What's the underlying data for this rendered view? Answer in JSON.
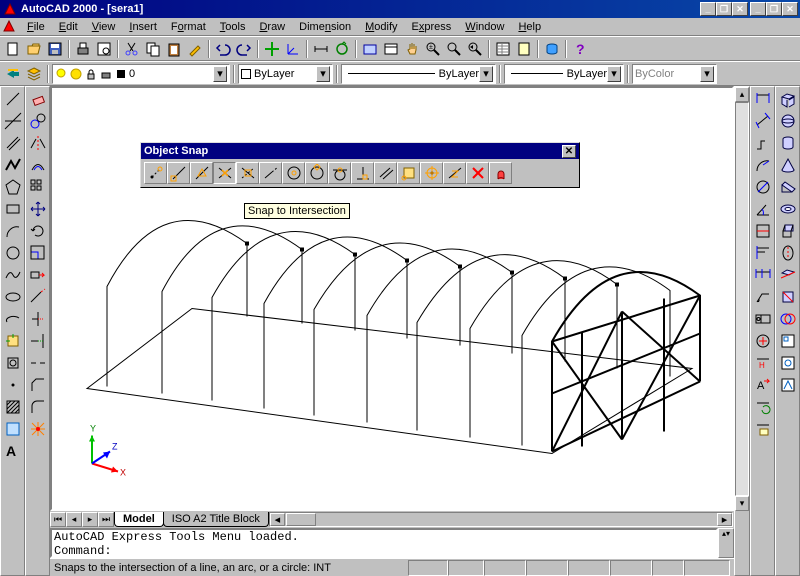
{
  "app": {
    "title": "AutoCAD 2000 - [sera1]"
  },
  "menu": {
    "items": [
      "File",
      "Edit",
      "View",
      "Insert",
      "Format",
      "Tools",
      "Draw",
      "Dimension",
      "Modify",
      "Express",
      "Window",
      "Help"
    ]
  },
  "toolbar2": {
    "layer": "0",
    "color_combo": "ByLayer",
    "linetype_combo": "ByLayer",
    "lineweight_combo": "ByLayer",
    "plotstyle_combo": "ByColor"
  },
  "tabs": {
    "active": "Model",
    "other": "ISO A2 Title Block"
  },
  "command": {
    "line1": "AutoCAD Express Tools Menu loaded.",
    "line2": "Command:"
  },
  "status": {
    "text": "Snaps to the intersection of a line, an arc, or a circle:  INT"
  },
  "osnap": {
    "title": "Object Snap"
  },
  "tooltip": {
    "text": "Snap to Intersection"
  }
}
